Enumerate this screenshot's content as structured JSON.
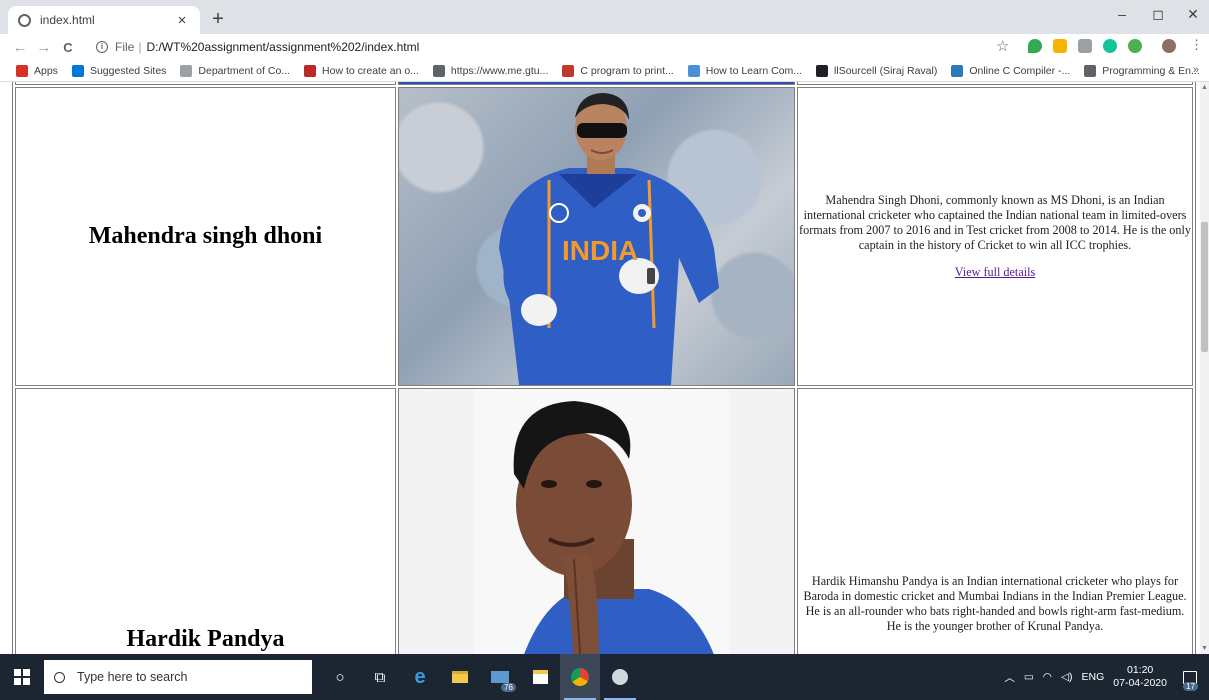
{
  "browser": {
    "tab_title": "index.html",
    "tab_close": "×",
    "new_tab": "+",
    "window_controls": {
      "minimize": "–",
      "maximize": "◻",
      "close": "✕"
    },
    "nav": {
      "back": "←",
      "forward": "→",
      "reload": "C"
    },
    "address": {
      "scheme": "File",
      "separator": "|",
      "url": "D:/WT%20assignment/assignment%202/index.html"
    },
    "bookmarks": [
      {
        "label": "Apps",
        "color": "#d93025"
      },
      {
        "label": "Suggested Sites",
        "color": "#0078d7"
      },
      {
        "label": "Department of Co...",
        "color": "#9aa0a6"
      },
      {
        "label": "How to create an o...",
        "color": "#b92b27"
      },
      {
        "label": "https://www.me.gtu...",
        "color": "#5f6368"
      },
      {
        "label": "C program to print...",
        "color": "#c0392b"
      },
      {
        "label": "How to Learn Com...",
        "color": "#4a90d9"
      },
      {
        "label": "llSourcell (Siraj Raval)",
        "color": "#202124"
      },
      {
        "label": "Online C Compiler -...",
        "color": "#2b7bb9"
      },
      {
        "label": "Programming & En...",
        "color": "#5f6368"
      }
    ],
    "bookmarks_more": "»"
  },
  "players": [
    {
      "name": "Mahendra singh dhoni",
      "description": "Mahendra Singh Dhoni, commonly known as MS Dhoni, is an Indian international cricketer who captained the Indian national team in limited-overs formats from 2007 to 2016 and in Test cricket from 2008 to 2014. He is the only captain in the history of Cricket to win all ICC trophies.",
      "link": "View full details",
      "jersey_text": "INDIA"
    },
    {
      "name": "Hardik Pandya",
      "description": "Hardik Himanshu Pandya is an Indian international cricketer who plays for Baroda in domestic cricket and Mumbai Indians in the Indian Premier League. He is an all-rounder who bats right-handed and bowls right-arm fast-medium. He is the younger brother of Krunal Pandya."
    }
  ],
  "taskbar": {
    "search_placeholder": "Type here to search",
    "mail_badge": "76",
    "tray_lang": "ENG",
    "time": "01:20",
    "date": "07-04-2020",
    "notifications": "17"
  },
  "colors": {
    "link_visited": "#551a8b",
    "taskbar": "#1c2633",
    "jersey": "#2f5fc4"
  }
}
